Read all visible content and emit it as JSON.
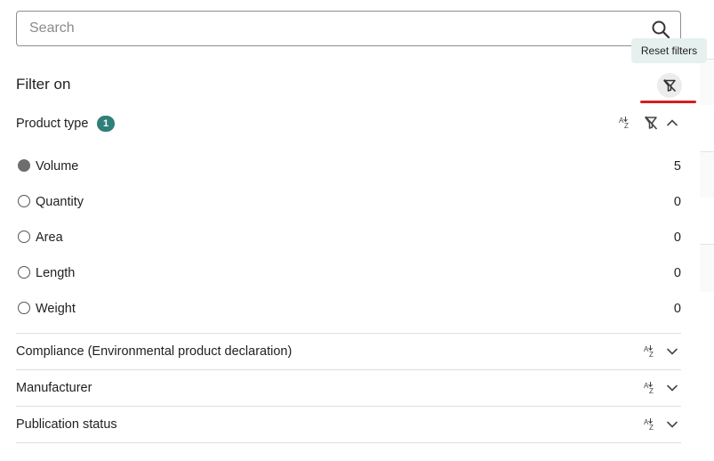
{
  "search": {
    "placeholder": "Search",
    "value": ""
  },
  "tooltip": {
    "text": "Reset filters"
  },
  "filter": {
    "title": "Filter on"
  },
  "groups": [
    {
      "label": "Product type",
      "badge": "1",
      "expanded": true,
      "options": [
        {
          "label": "Volume",
          "count": "5",
          "selected": true
        },
        {
          "label": "Quantity",
          "count": "0",
          "selected": false
        },
        {
          "label": "Area",
          "count": "0",
          "selected": false
        },
        {
          "label": "Length",
          "count": "0",
          "selected": false
        },
        {
          "label": "Weight",
          "count": "0",
          "selected": false
        }
      ]
    },
    {
      "label": "Compliance (Environmental product declaration)",
      "expanded": false
    },
    {
      "label": "Manufacturer",
      "expanded": false
    },
    {
      "label": "Publication status",
      "expanded": false
    }
  ],
  "colors": {
    "accent": "#2f7f7a",
    "highlight": "#d51f1f",
    "tooltip_bg": "#e6f0ef"
  },
  "icons": [
    "search-icon",
    "filter-off-icon",
    "sort-az-icon",
    "chevron-up-icon",
    "chevron-down-icon"
  ]
}
